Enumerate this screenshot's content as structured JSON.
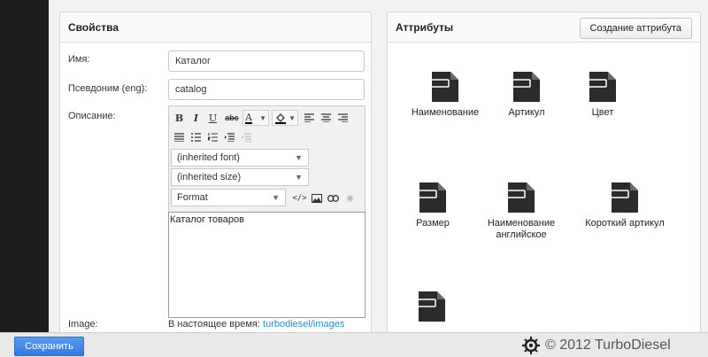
{
  "properties": {
    "title": "Свойства",
    "name_label": "Имя:",
    "name_value": "Каталог",
    "alias_label": "Псевдоним (eng):",
    "alias_value": "catalog",
    "description_label": "Описание:",
    "editor": {
      "bold": "B",
      "italic": "I",
      "underline": "U",
      "strike": "abc",
      "font_color": "A",
      "font_select": "(inherited font)",
      "size_select": "(inherited size)",
      "format_select": "Format",
      "content": "Каталог товаров"
    },
    "image_label": "Image:",
    "image_prefix": "В настоящее время:",
    "image_link": "turbodiesel/images"
  },
  "attributes": {
    "title": "Аттрибуты",
    "create_button": "Создание аттрибута",
    "items": [
      {
        "label": "Наименование",
        "icon": "document-icon"
      },
      {
        "label": "Артикул",
        "icon": "document-icon"
      },
      {
        "label": "Цвет",
        "icon": "document-icon"
      },
      {
        "label": "Размер",
        "icon": "document-icon"
      },
      {
        "label": "Наименование английское",
        "icon": "document-icon"
      },
      {
        "label": "Короткий артикул",
        "icon": "document-icon"
      },
      {
        "label": "",
        "icon": "document-icon"
      }
    ]
  },
  "footer": {
    "save_button": "Сохранить",
    "copyright": "© 2012 TurboDiesel"
  },
  "colors": {
    "accent": "#3478e0",
    "link": "#2a8cc7",
    "sidebar": "#1e1e1e",
    "icon": "#2b2b2b"
  }
}
